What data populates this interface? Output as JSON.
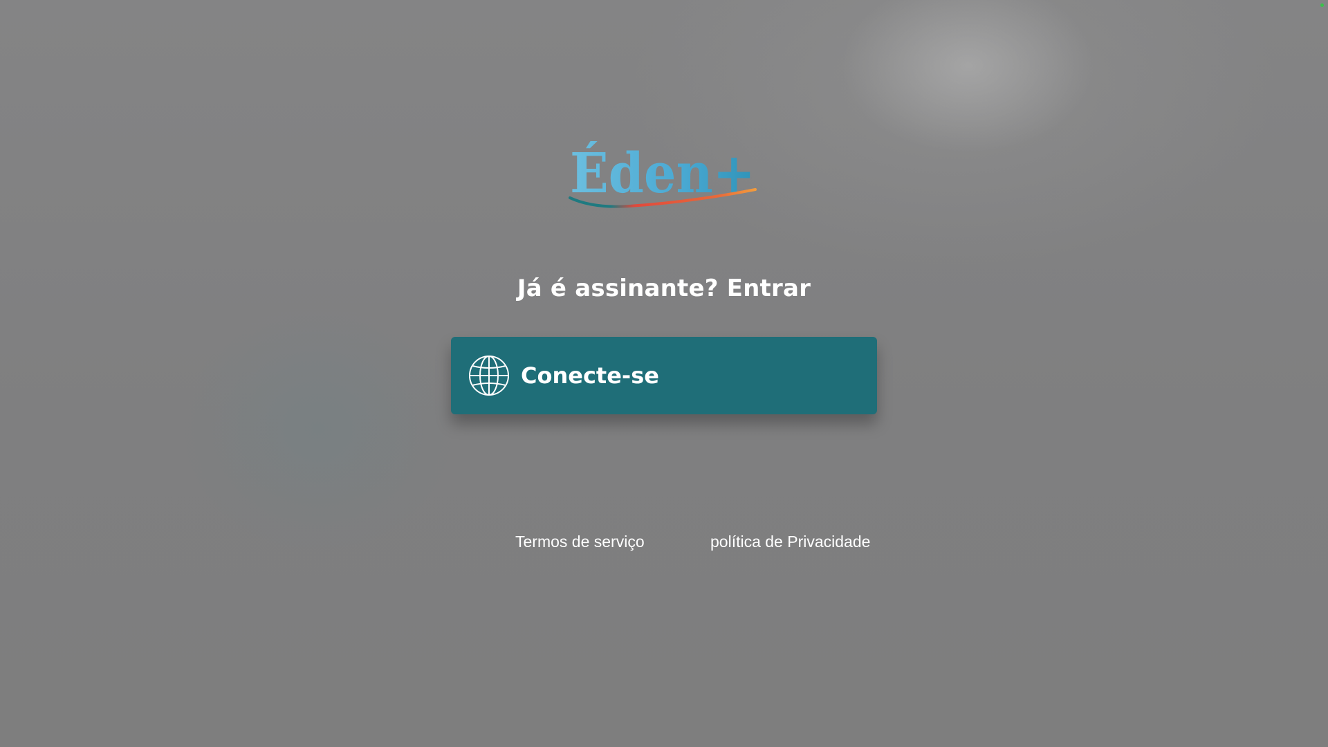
{
  "brand": {
    "logo_text": "Éden+",
    "colors": {
      "logo_blue": "#5ab4d6",
      "logo_plus": "#23858f",
      "swoosh_teal": "#1f7a80",
      "swoosh_red": "#e0493c",
      "swoosh_orange": "#f39c3d"
    }
  },
  "login": {
    "headline": "Já é assinante? Entrar",
    "connect_button": {
      "label": "Conecte-se",
      "icon": "globe-icon",
      "color": "#1f6e78"
    }
  },
  "footer": {
    "terms_label": "Termos de serviço",
    "privacy_label": "política de Privacidade"
  },
  "indicator": {
    "color": "#39c24a"
  }
}
